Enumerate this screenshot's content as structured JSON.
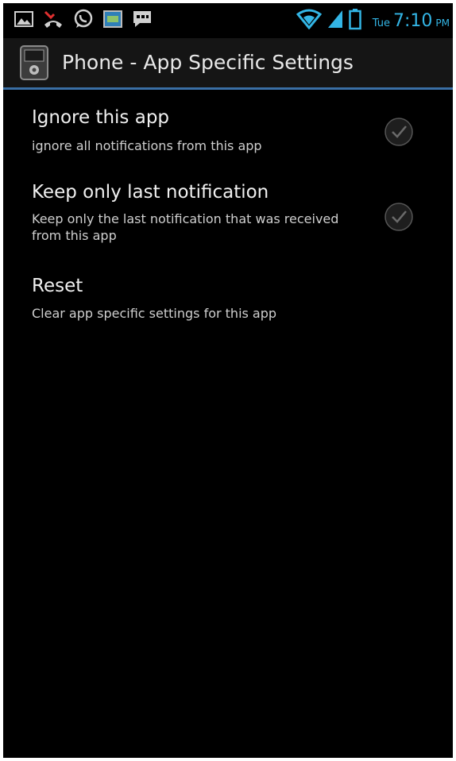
{
  "status_bar": {
    "icons_left": [
      "gallery-icon",
      "missed-call-icon",
      "whatsapp-icon",
      "image-notification-icon",
      "message-icon"
    ],
    "icons_right": [
      "wifi-icon",
      "signal-icon",
      "battery-icon"
    ],
    "clock_day": "Tue",
    "clock_time": "7:10",
    "clock_ampm": "PM",
    "accent_color": "#33b5e5"
  },
  "action_bar": {
    "icon": "phone-app-icon",
    "title": "Phone - App Specific Settings",
    "divider_color": "#3a6fa5"
  },
  "settings": [
    {
      "title": "Ignore this app",
      "summary": "ignore all notifications from this app",
      "has_checkbox": true,
      "checked": false
    },
    {
      "title": "Keep only last notification",
      "summary": "Keep only the last notification that was received from this app",
      "has_checkbox": true,
      "checked": false
    },
    {
      "title": "Reset",
      "summary": "Clear app specific settings for this app",
      "has_checkbox": false
    }
  ]
}
